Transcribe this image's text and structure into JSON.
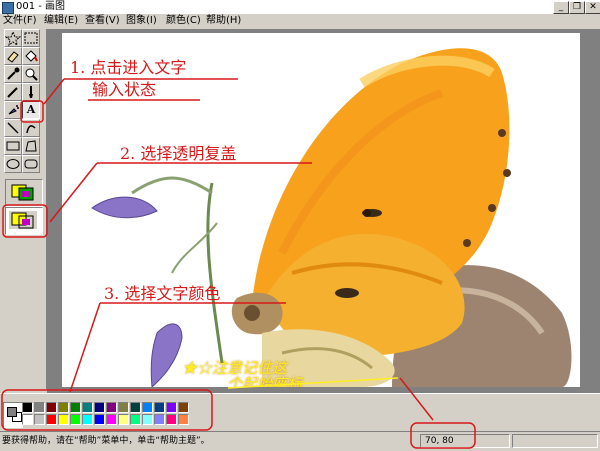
{
  "window": {
    "title": "001 - 画图",
    "minimize": "_",
    "restore": "❐",
    "close": "✕"
  },
  "menubar": [
    "文件(F)",
    "编辑(E)",
    "查看(V)",
    "图象(I)",
    "颜色(C)",
    "帮助(H)"
  ],
  "toolbox": {
    "tools": [
      "free-select",
      "rect-select",
      "eraser",
      "fill",
      "color-picker",
      "magnifier",
      "pencil",
      "brush",
      "airbrush",
      "text",
      "line",
      "curve",
      "rectangle",
      "polygon",
      "ellipse",
      "rounded-rectangle"
    ],
    "text_tool_glyph": "A",
    "active_tool": "text",
    "options": [
      "opaque-background",
      "transparent-background"
    ],
    "selected_option": "transparent-background"
  },
  "palette": {
    "foreground": "#808080",
    "background": "#ffffff",
    "colors_row1": [
      "#000000",
      "#808080",
      "#800000",
      "#808000",
      "#008000",
      "#008080",
      "#000080",
      "#800080",
      "#808040",
      "#004040",
      "#0080ff",
      "#004080",
      "#8000ff",
      "#804000"
    ],
    "colors_row2": [
      "#ffffff",
      "#c0c0c0",
      "#ff0000",
      "#ffff00",
      "#00ff00",
      "#00ffff",
      "#0000ff",
      "#ff00ff",
      "#ffff80",
      "#00ff80",
      "#80ffff",
      "#8080ff",
      "#ff0080",
      "#ff8040"
    ]
  },
  "status": {
    "help_text": "要获得帮助，请在“帮助”菜单中，单击“帮助主题”。",
    "coords": "70, 80"
  },
  "annotations": {
    "step1_line1": "1. 点击进入文字",
    "step1_line2": "输入状态",
    "step2": "2. 选择透明复盖",
    "step3": "3. 选择文字颜色",
    "note_line1": "★☆注意记住这",
    "note_line2": "个起始座标",
    "red": "#d81818",
    "yellow": "#ffee22"
  }
}
